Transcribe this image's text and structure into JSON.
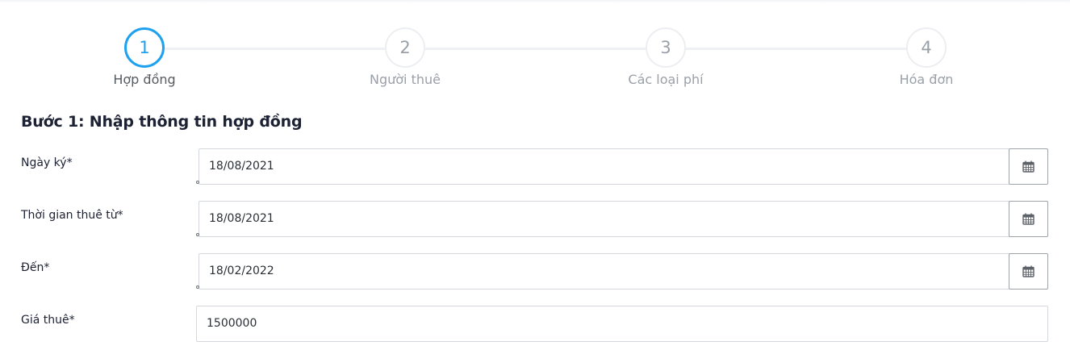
{
  "stepper": {
    "steps": [
      {
        "number": "1",
        "label": "Hợp đồng",
        "active": true
      },
      {
        "number": "2",
        "label": "Người thuê",
        "active": false
      },
      {
        "number": "3",
        "label": "Các loại phí",
        "active": false
      },
      {
        "number": "4",
        "label": "Hóa đơn",
        "active": false
      }
    ]
  },
  "form": {
    "title": "Bước 1: Nhập thông tin hợp đồng",
    "fields": {
      "sign_date": {
        "label": "Ngày ký*",
        "value": "18/08/2021"
      },
      "rent_from": {
        "label": "Thời gian thuê từ*",
        "value": "18/08/2021"
      },
      "rent_to": {
        "label": "Đến*",
        "value": "18/02/2022"
      },
      "price": {
        "label": "Giá thuê*",
        "value": "1500000"
      }
    }
  },
  "icons": {
    "calendar": "calendar-icon"
  },
  "colors": {
    "active_step": "#1ea1ee",
    "inactive_step": "#9aa0a8",
    "title": "#1c2233"
  }
}
